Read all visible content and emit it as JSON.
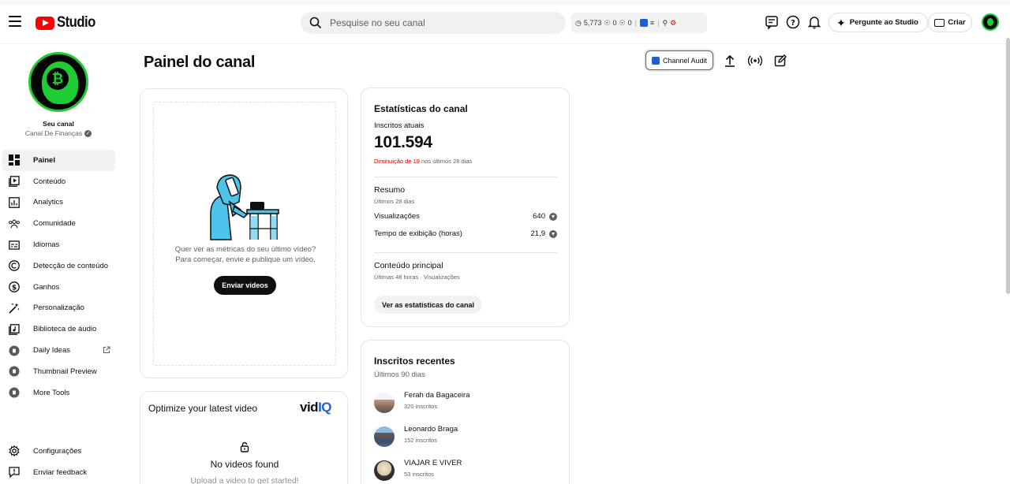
{
  "header": {
    "logo_text": "Studio",
    "search_placeholder": "Pesquise no seu canal",
    "ext_stats": {
      "views": "5,773",
      "likes": "0",
      "comments": "0"
    },
    "ask_label": "Pergunte ao Studio",
    "create_label": "Criar"
  },
  "sidebar": {
    "channel_label": "Seu canal",
    "channel_name": "Canal De Finanças",
    "items": [
      {
        "label": "Painel",
        "icon": "dashboard-icon",
        "active": true
      },
      {
        "label": "Conteúdo",
        "icon": "content-icon"
      },
      {
        "label": "Analytics",
        "icon": "analytics-icon"
      },
      {
        "label": "Comunidade",
        "icon": "community-icon"
      },
      {
        "label": "Idiomas",
        "icon": "subtitles-icon"
      },
      {
        "label": "Detecção de conteúdo",
        "icon": "copyright-icon"
      },
      {
        "label": "Ganhos",
        "icon": "dollar-icon"
      },
      {
        "label": "Personalização",
        "icon": "magic-wand-icon"
      },
      {
        "label": "Biblioteca de áudio",
        "icon": "audio-library-icon"
      },
      {
        "label": "Daily Ideas",
        "icon": "vidiq-icon",
        "external": true
      },
      {
        "label": "Thumbnail Preview",
        "icon": "vidiq-icon"
      },
      {
        "label": "More Tools",
        "icon": "vidiq-icon"
      }
    ],
    "bottom": [
      {
        "label": "Configurações",
        "icon": "gear-icon"
      },
      {
        "label": "Enviar feedback",
        "icon": "feedback-icon"
      }
    ]
  },
  "main": {
    "title": "Painel do canal",
    "audit_label": "Channel Audit",
    "upload": {
      "line1": "Quer ver as métricas do seu último vídeo?",
      "line2": "Para começar, envie e publique um vídeo.",
      "button": "Enviar vídeos"
    },
    "optimize": {
      "title": "Optimize your latest video",
      "brand_vid": "vid",
      "brand_iq": "IQ",
      "empty_title": "No videos found",
      "empty_sub": "Upload a video to get started!"
    },
    "stats": {
      "title": "Estatísticas do canal",
      "subs_label": "Inscritos atuais",
      "subs_value": "101.594",
      "trend_neg": "Diminuição de 19",
      "trend_rest": "nos últimos 28 dias",
      "summary_title": "Resumo",
      "summary_period": "Últimos 28 dias",
      "rows": [
        {
          "label": "Visualizações",
          "value": "640"
        },
        {
          "label": "Tempo de exibição (horas)",
          "value": "21,9"
        }
      ],
      "top_title": "Conteúdo principal",
      "top_period": "Últimas 48 horas · Visualizações",
      "button": "Ver as estatísticas do canal"
    },
    "recent_subs": {
      "title": "Inscritos recentes",
      "period": "Últimos 90 dias",
      "items": [
        {
          "name": "Ferah da Bagaceira",
          "count": "320 inscritos"
        },
        {
          "name": "Leonardo Braga",
          "count": "152 inscritos"
        },
        {
          "name": "VIAJAR E VIVER",
          "count": "53 inscritos"
        }
      ]
    }
  },
  "colors": {
    "accent_red": "#ff0000",
    "brand_green": "#1fcc36",
    "vidiq_blue": "#1f5fd6",
    "negative": "#cc0000"
  }
}
